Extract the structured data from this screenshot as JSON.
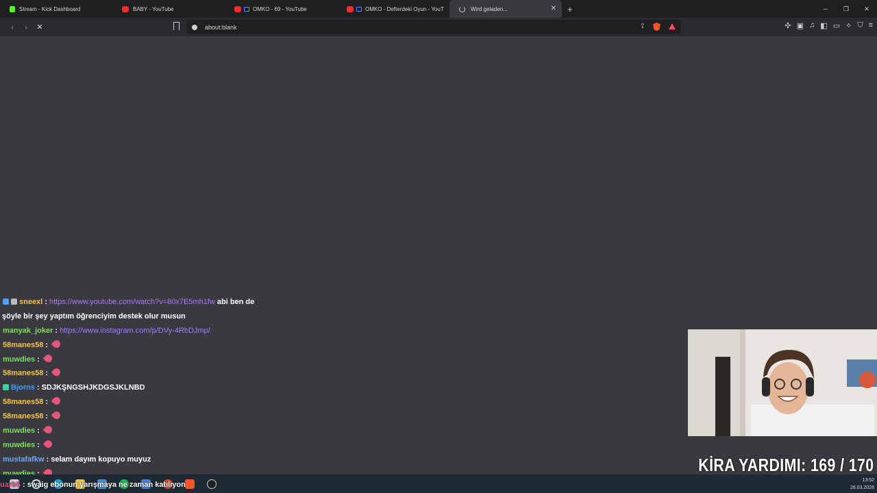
{
  "tabs": [
    {
      "title": "Stream - Kick Dashboard",
      "favicon": "kick-icon",
      "active": false
    },
    {
      "title": "BABY - YouTube",
      "favicon": "youtube-icon",
      "active": false
    },
    {
      "title": "OMKO - 69 - YouTube",
      "favicon": "youtube-icon",
      "active": false
    },
    {
      "title": "OMKO - Defterdeki Oyun - YouTube",
      "favicon": "youtube-icon",
      "active": false
    },
    {
      "title": "Wird geladen...",
      "favicon": "loading-icon",
      "active": true
    }
  ],
  "address": {
    "url": "about:blank"
  },
  "chat": [
    {
      "user": "sneexl",
      "user_color": "#f5c542",
      "badges": [
        "#4aa3ff",
        "#bbbbbb"
      ],
      "link": "https://www.youtube.com/watch?v=80x7E5mh1fw",
      "text": "abi ben de"
    },
    {
      "user": "",
      "user_color": "#ffffff",
      "badges": [],
      "link": "",
      "text": "şöyle bir şey yaptım öğrenciyim destek olur musun"
    },
    {
      "user": "manyak_joker",
      "user_color": "#7ee05a",
      "badges": [],
      "link": "https://www.instagram.com/p/DVy-4RbDJmp/",
      "text": ""
    },
    {
      "user": "58manes58",
      "user_color": "#f5c542",
      "badges": [],
      "link": "",
      "text": "",
      "emote": true
    },
    {
      "user": "muwdies",
      "user_color": "#7ee05a",
      "badges": [],
      "link": "",
      "text": "",
      "emote": true
    },
    {
      "user": "58manes58",
      "user_color": "#f5c542",
      "badges": [],
      "link": "",
      "text": "",
      "emote": true
    },
    {
      "user": "Bjorns",
      "user_color": "#3aa0ff",
      "badges": [
        "#3ad1a0"
      ],
      "link": "",
      "text": "SDJKŞNGSHJKDGSJKLNBD"
    },
    {
      "user": "58manes58",
      "user_color": "#f5c542",
      "badges": [],
      "link": "",
      "text": "",
      "emote": true
    },
    {
      "user": "58manes58",
      "user_color": "#f5c542",
      "badges": [],
      "link": "",
      "text": "",
      "emote": true
    },
    {
      "user": "muwdies",
      "user_color": "#7ee05a",
      "badges": [],
      "link": "",
      "text": "",
      "emote": true
    },
    {
      "user": "muwdies",
      "user_color": "#7ee05a",
      "badges": [],
      "link": "",
      "text": "",
      "emote": true
    },
    {
      "user": "mustafafkw",
      "user_color": "#6aa8ff",
      "badges": [],
      "link": "",
      "text": "selam dayım kopuyo muyuz"
    },
    {
      "user": "muwdies",
      "user_color": "#7ee05a",
      "badges": [],
      "link": "",
      "text": "",
      "emote": true
    }
  ],
  "overlay": {
    "kira_text": "KİRA YARDIMI:  169 / 170"
  },
  "taskbar_message": {
    "user": "uarb5",
    "text": "swaig ebonun yarışmaya ne zaman katılıyon"
  },
  "clock": {
    "time": "13:52",
    "date": "26.03.2026"
  }
}
